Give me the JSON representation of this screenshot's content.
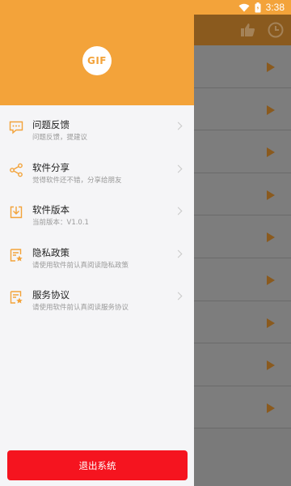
{
  "status_bar": {
    "time": "3:38"
  },
  "drawer": {
    "logo_text": "GIF",
    "menu": [
      {
        "title": "问题反馈",
        "subtitle": "问题反馈，提建议",
        "icon": "feedback-icon"
      },
      {
        "title": "软件分享",
        "subtitle": "觉得软件还不错，分享给朋友",
        "icon": "share-icon"
      },
      {
        "title": "软件版本",
        "subtitle": "当前版本：V1.0.1",
        "icon": "download-icon"
      },
      {
        "title": "隐私政策",
        "subtitle": "请使用软件前认真阅读隐私政策",
        "icon": "policy-icon"
      },
      {
        "title": "服务协议",
        "subtitle": "请使用软件前认真阅读服务协议",
        "icon": "agreement-icon"
      }
    ],
    "logout_label": "退出系统"
  },
  "colors": {
    "accent": "#f3a33a",
    "logout": "#f5141f",
    "overlay_bg": "#7a7a7a"
  }
}
